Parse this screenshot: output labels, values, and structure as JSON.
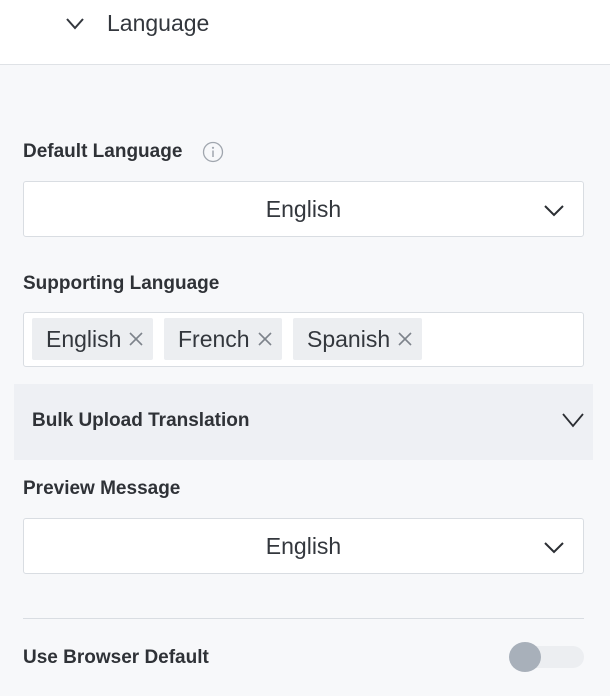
{
  "header": {
    "title": "Language",
    "icon": "chevron-down-icon"
  },
  "default_language": {
    "label": "Default Language",
    "selected": "English",
    "info_icon": "info-icon"
  },
  "supporting_language": {
    "label": "Supporting Language",
    "tags": [
      "English",
      "French",
      "Spanish"
    ]
  },
  "bulk_upload": {
    "label": "Bulk Upload Translation"
  },
  "preview_message": {
    "label": "Preview Message",
    "selected": "English"
  },
  "browser_default": {
    "label": "Use Browser Default",
    "enabled": false
  },
  "colors": {
    "panel_bg": "#f7f8fa",
    "accordion_bg": "#eef0f4",
    "tag_bg": "#eceef1",
    "border": "#d9dde2",
    "toggle_knob": "#a8b0ba"
  }
}
